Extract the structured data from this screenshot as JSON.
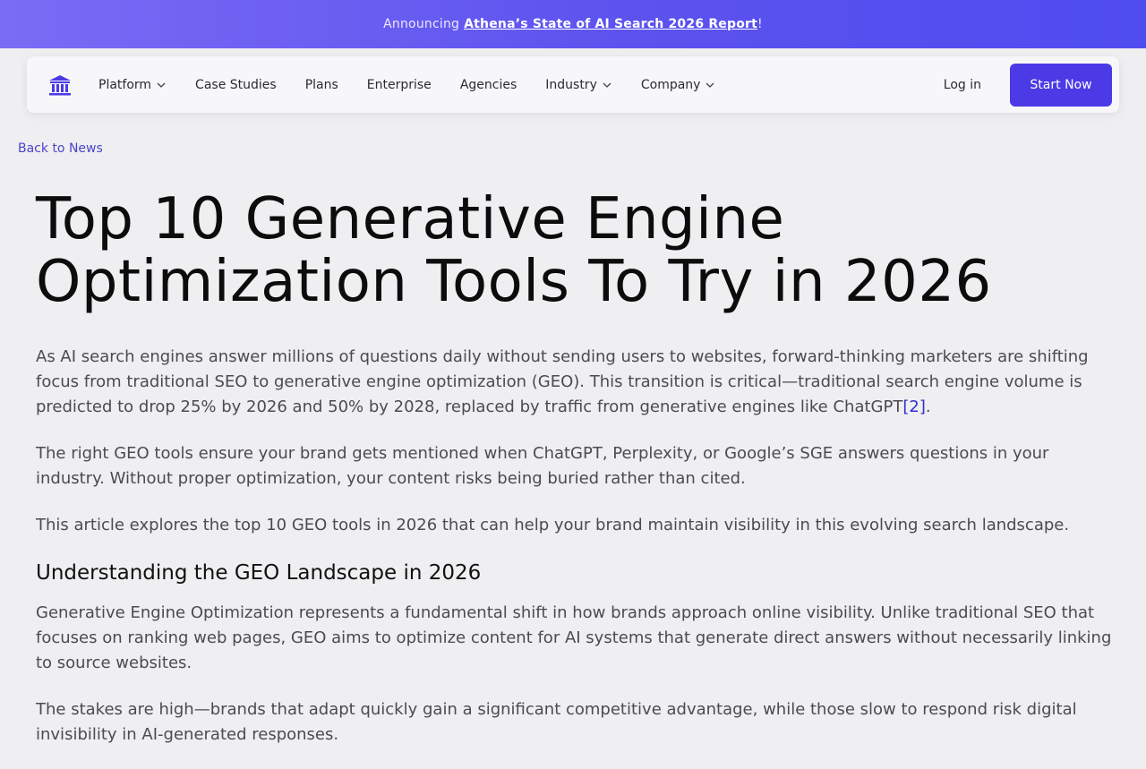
{
  "announcement": {
    "prefix": "Announcing",
    "link": "Athena’s State of AI Search 2026 Report",
    "suffix": "!"
  },
  "nav": {
    "items": [
      {
        "label": "Platform",
        "dropdown": true
      },
      {
        "label": "Case Studies",
        "dropdown": false
      },
      {
        "label": "Plans",
        "dropdown": false
      },
      {
        "label": "Enterprise",
        "dropdown": false
      },
      {
        "label": "Agencies",
        "dropdown": false
      },
      {
        "label": "Industry",
        "dropdown": true
      },
      {
        "label": "Company",
        "dropdown": true
      }
    ],
    "login": "Log in",
    "cta": "Start Now"
  },
  "back_link": "Back to News",
  "article": {
    "title_line1": "Top 10 Generative Engine",
    "title_line2": "Optimization Tools To Try in 2026",
    "p1": "As AI search engines answer millions of questions daily without sending users to websites, forward-thinking marketers are shifting focus from traditional SEO to generative engine optimization (GEO). This transition is critical—traditional search engine volume is predicted to drop 25% by 2026 and 50% by 2028, replaced by traffic from generative engines like ChatGPT",
    "p1_ref": "[2]",
    "p1_end": ".",
    "p2": "The right GEO tools ensure your brand gets mentioned when ChatGPT, Perplexity, or Google’s SGE answers questions in your industry. Without proper optimization, your content risks being buried rather than cited.",
    "p3": "This article explores the top 10 GEO tools in 2026 that can help your brand maintain visibility in this evolving search landscape.",
    "h2": "Understanding the GEO Landscape in 2026",
    "p4": "Generative Engine Optimization represents a fundamental shift in how brands approach online visibility. Unlike traditional SEO that focuses on ranking web pages, GEO aims to optimize content for AI systems that generate direct answers without necessarily linking to source websites.",
    "p5": "The stakes are high—brands that adapt quickly gain a significant competitive advantage, while those slow to respond risk digital invisibility in AI-generated responses."
  },
  "colors": {
    "accent": "#4b3ae6",
    "banner_start": "#7b6cf5",
    "banner_end": "#4f4cf0",
    "link": "#4a45c8"
  },
  "icons": {
    "logo": "bank-icon",
    "dropdown": "chevron-down-icon"
  }
}
